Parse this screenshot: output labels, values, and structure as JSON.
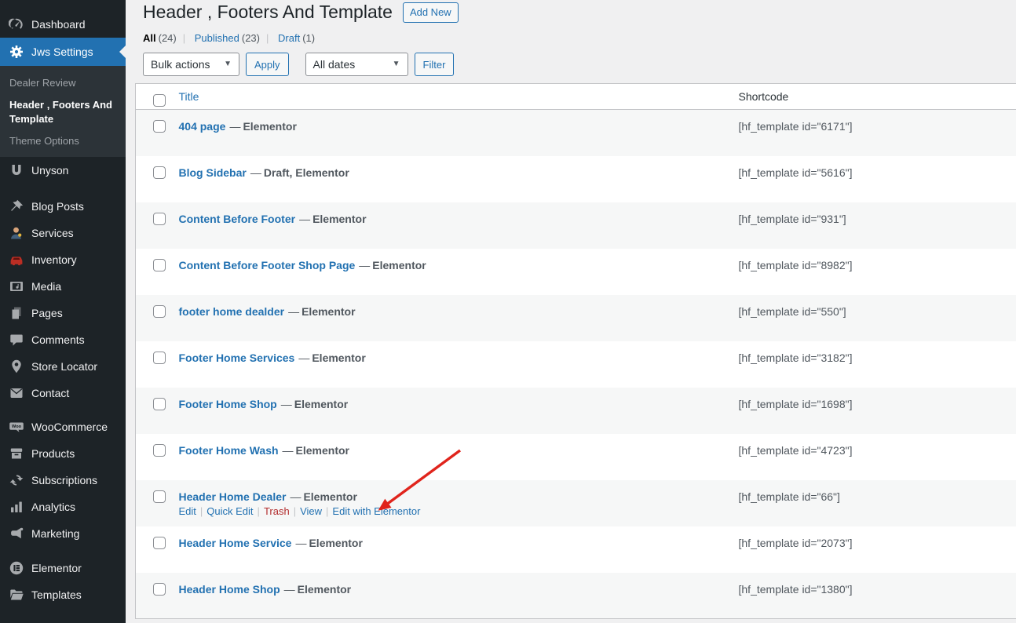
{
  "colors": {
    "accent": "#2271b1",
    "arrow-red": "#e0241c",
    "sidebar-bg": "#1d2327",
    "submenu-bg": "#2c3338",
    "stripe": "#f6f7f7",
    "danger": "#b32d2e",
    "content-bg": "#f0f0f1"
  },
  "sidebar": {
    "items": [
      {
        "label": "Dashboard",
        "icon": "dashboard-icon"
      },
      {
        "label": "Jws Settings",
        "icon": "gear-icon",
        "active": true
      },
      {
        "label": "Unyson",
        "icon": "unyson-icon"
      },
      {
        "label": "Blog Posts",
        "icon": "pushpin-icon"
      },
      {
        "label": "Services",
        "icon": "services-person-icon"
      },
      {
        "label": "Inventory",
        "icon": "car-icon"
      },
      {
        "label": "Media",
        "icon": "media-icon"
      },
      {
        "label": "Pages",
        "icon": "pages-icon"
      },
      {
        "label": "Comments",
        "icon": "comment-bubble-icon"
      },
      {
        "label": "Store Locator",
        "icon": "location-pin-icon"
      },
      {
        "label": "Contact",
        "icon": "envelope-icon"
      },
      {
        "label": "WooCommerce",
        "icon": "woocommerce-icon"
      },
      {
        "label": "Products",
        "icon": "archive-box-icon"
      },
      {
        "label": "Subscriptions",
        "icon": "refresh-arrows-icon"
      },
      {
        "label": "Analytics",
        "icon": "bar-chart-icon"
      },
      {
        "label": "Marketing",
        "icon": "megaphone-icon"
      },
      {
        "label": "Elementor",
        "icon": "elementor-logo-icon"
      },
      {
        "label": "Templates",
        "icon": "folder-icon"
      }
    ],
    "submenu": {
      "items": [
        {
          "label": "Dealer Review"
        },
        {
          "label": "Header , Footers And Template",
          "current": true
        },
        {
          "label": "Theme Options"
        }
      ]
    }
  },
  "header": {
    "title": "Header , Footers And Template",
    "add_new_label": "Add New"
  },
  "filters": {
    "views": [
      {
        "label": "All",
        "count": "(24)",
        "current": true
      },
      {
        "label": "Published",
        "count": "(23)"
      },
      {
        "label": "Draft",
        "count": "(1)"
      }
    ],
    "bulk_actions_value": "Bulk actions",
    "apply_label": "Apply",
    "dates_value": "All dates",
    "filter_label": "Filter"
  },
  "table": {
    "columns": {
      "title": "Title",
      "shortcode": "Shortcode"
    },
    "state_separator": "—",
    "row_actions": [
      {
        "label": "Edit"
      },
      {
        "label": "Quick Edit"
      },
      {
        "label": "Trash"
      },
      {
        "label": "View"
      },
      {
        "label": "Edit with Elementor"
      }
    ],
    "rows": [
      {
        "title": "404 page",
        "state": "Elementor",
        "shortcode": "[hf_template id=\"6171\"]"
      },
      {
        "title": "Blog Sidebar",
        "state": "Draft, Elementor",
        "shortcode": "[hf_template id=\"5616\"]"
      },
      {
        "title": "Content Before Footer",
        "state": "Elementor",
        "shortcode": "[hf_template id=\"931\"]"
      },
      {
        "title": "Content Before Footer Shop Page",
        "state": "Elementor",
        "shortcode": "[hf_template id=\"8982\"]"
      },
      {
        "title": "footer home dealder",
        "state": "Elementor",
        "shortcode": "[hf_template id=\"550\"]"
      },
      {
        "title": "Footer Home Services",
        "state": "Elementor",
        "shortcode": "[hf_template id=\"3182\"]"
      },
      {
        "title": "Footer Home Shop",
        "state": "Elementor",
        "shortcode": "[hf_template id=\"1698\"]"
      },
      {
        "title": "Footer Home Wash",
        "state": "Elementor",
        "shortcode": "[hf_template id=\"4723\"]"
      },
      {
        "title": "Header Home Dealer",
        "state": "Elementor",
        "shortcode": "[hf_template id=\"66\"]",
        "show_actions": true
      },
      {
        "title": "Header Home Service",
        "state": "Elementor",
        "shortcode": "[hf_template id=\"2073\"]"
      },
      {
        "title": "Header Home Shop",
        "state": "Elementor",
        "shortcode": "[hf_template id=\"1380\"]"
      }
    ]
  }
}
